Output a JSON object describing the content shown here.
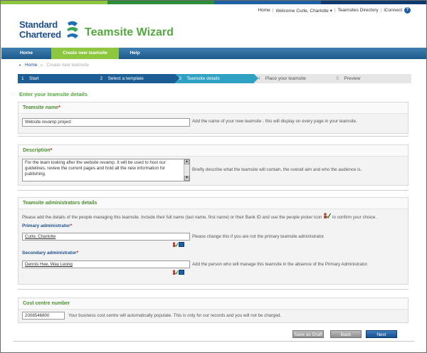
{
  "colors": {
    "stripe": [
      "#8dc63f",
      "#2b8f3a",
      "#1e5fa8",
      "#0d3a6e"
    ],
    "brand_blue": "#1d4f91",
    "brand_green": "#53a93f",
    "nav_active": "#8dc63f",
    "required": "#d11111"
  },
  "topbar": {
    "home": "Home",
    "welcome": "Welcome Curle, Charlotte",
    "directory": "Teamsites Directory",
    "iconnect": "iConnect",
    "help_icon": "?"
  },
  "logo": {
    "line1": "Standard",
    "line2": "Chartered"
  },
  "app_title": "Teamsite Wizard",
  "nav": [
    "Home",
    "Create new teamsite",
    "Help"
  ],
  "breadcrumb": {
    "home": "Home",
    "current": "Create new teamsite"
  },
  "steps": [
    {
      "num": "1",
      "label": "Start"
    },
    {
      "num": "2",
      "label": "Select a template"
    },
    {
      "num": "3",
      "label": "Teamsite details"
    },
    {
      "num": "4",
      "label": "Place your teamsite"
    },
    {
      "num": "5",
      "label": "Preview"
    }
  ],
  "section_title": "Enter your teamsite details",
  "teamsite_name": {
    "title": "Teamsite name",
    "required_mark": "*",
    "value": "Website revamp project",
    "help": "Add the name of your new teamsite - this will display on every page in your teamsite."
  },
  "description": {
    "title": "Description",
    "required_mark": "*",
    "value": "For the team looking after the website revamp. It will be used to host our guidelines, review the current pages and hold all the new information for publishing.",
    "help": "Briefly describe what the teamsite will contain, the overall aim and who the audience is."
  },
  "admins": {
    "title": "Teamsite administrators details",
    "intro": "Please add the details of the people managing this teamsite. Include their full name (last name, first name) or their Bank ID and use the people picker icon",
    "intro_end": "to confirm your choice.",
    "primary_label": "Primary administrator",
    "primary_value": "Curle, Charlotte",
    "primary_help": "Please change this if you are not the primary teamsite administrator.",
    "secondary_label": "Secondary administrator",
    "secondary_value": "Dennis Hee, Way Leong",
    "secondary_help": "Add the person who will manage this teamsite in the absence of the Primary Administrator."
  },
  "cost_centre": {
    "title": "Cost centre number",
    "value": "2008546800",
    "help": "Your business cost centre will automatically populate. This is only for our records and you will not be charged."
  },
  "buttons": {
    "save": "Save as Draft",
    "back": "Back",
    "next": "Next"
  }
}
